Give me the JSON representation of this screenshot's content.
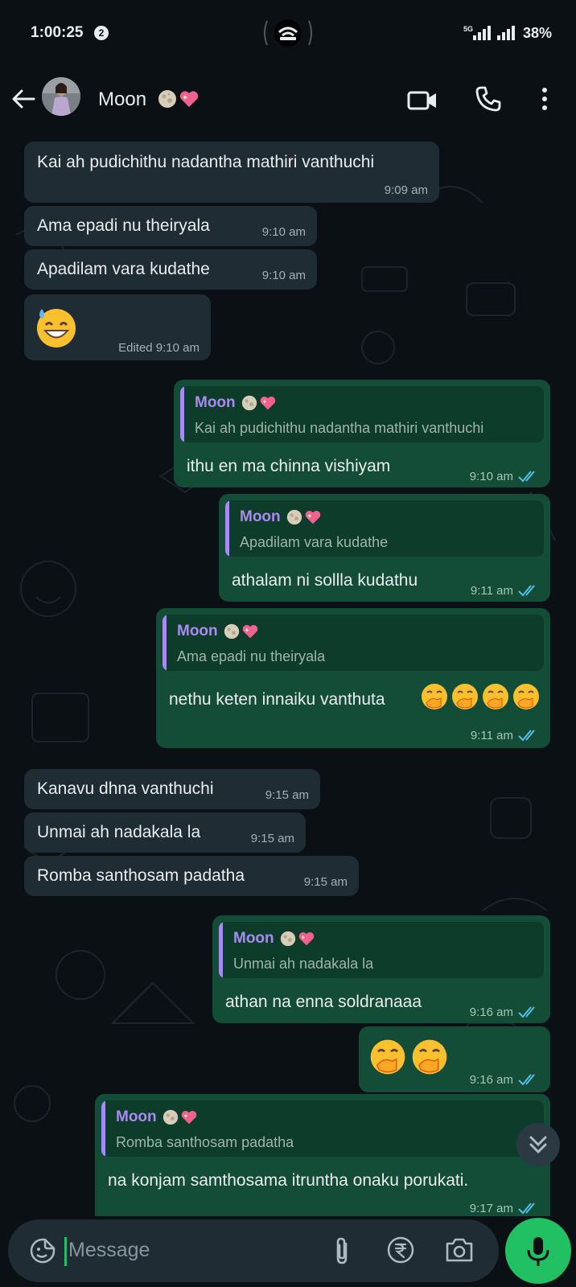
{
  "status_bar": {
    "time": "1:00:25",
    "notification_count": "2",
    "network_label": "5G",
    "battery": "38%"
  },
  "header": {
    "name": "Moon",
    "name_emojis": [
      "full-moon",
      "sparkling-heart"
    ]
  },
  "messages": [
    {
      "dir": "in",
      "text": "Kai ah pudichithu nadantha mathiri vanthuchi",
      "time": "9:09 am"
    },
    {
      "dir": "in",
      "text": "Ama epadi nu theiryala",
      "time": "9:10 am"
    },
    {
      "dir": "in",
      "text": "Apadilam vara kudathe",
      "time": "9:10 am"
    },
    {
      "dir": "in",
      "emoji": "grinning-sweat",
      "time": "Edited 9:10 am"
    },
    {
      "dir": "out",
      "quote_name": "Moon",
      "quote_text": "Kai ah pudichithu nadantha mathiri vanthuchi",
      "text": "ithu en ma chinna vishiyam",
      "time": "9:10 am"
    },
    {
      "dir": "out",
      "quote_name": "Moon",
      "quote_text": "Apadilam vara kudathe",
      "text": "athalam ni sollla kudathu",
      "time": "9:11 am"
    },
    {
      "dir": "out",
      "quote_name": "Moon",
      "quote_text": "Ama epadi nu theiryala",
      "text": "nethu keten innaiku vanthuta",
      "emojis": [
        "hand-over-mouth",
        "hand-over-mouth",
        "hand-over-mouth",
        "hand-over-mouth"
      ],
      "time": "9:11 am"
    },
    {
      "dir": "in",
      "text": "Kanavu dhna vanthuchi",
      "time": "9:15 am"
    },
    {
      "dir": "in",
      "text": "Unmai ah nadakala la",
      "time": "9:15 am"
    },
    {
      "dir": "in",
      "text": "Romba santhosam padatha",
      "time": "9:15 am"
    },
    {
      "dir": "out",
      "quote_name": "Moon",
      "quote_text": "Unmai ah nadakala la",
      "text": "athan na enna soldranaaa",
      "time": "9:16 am"
    },
    {
      "dir": "out",
      "emojis": [
        "hand-over-mouth",
        "hand-over-mouth"
      ],
      "time": "9:16 am"
    },
    {
      "dir": "out",
      "quote_name": "Moon",
      "quote_text": "Romba santhosam padatha",
      "text": "na konjam samthosama itruntha onaku porukati.",
      "time": "9:17 am"
    }
  ],
  "input": {
    "placeholder": "Message"
  },
  "colors": {
    "incoming_bubble": "#202c33",
    "outgoing_bubble": "#144d37",
    "quote_name": "#a98af0",
    "read_ticks": "#53bdeb",
    "accent": "#21c063"
  }
}
